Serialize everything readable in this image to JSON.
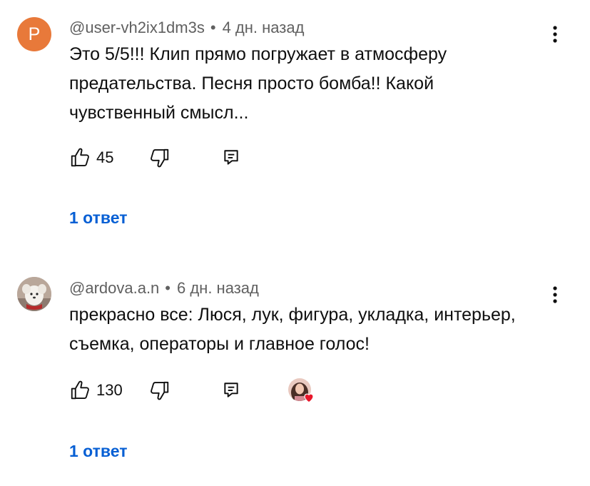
{
  "comments": [
    {
      "avatar_letter": "P",
      "avatar_color": "#e8793a",
      "author": "@user-vh2ix1dm3s",
      "separator": "•",
      "time": "4 дн. назад",
      "text": "Это 5/5!!! Клип прямо погружает в атмосферу предательства. Песня просто бомба!! Какой чувственный смысл...",
      "likes": "45",
      "replies_label": "1 ответ",
      "liked_by_creator": false
    },
    {
      "avatar_icon": "dog-photo-avatar",
      "author": "@ardova.a.n",
      "separator": "•",
      "time": "6 дн. назад",
      "text": "прекрасно все: Люся, лук, фигура, укладка, интерьер, съемка, операторы и главное голос!",
      "likes": "130",
      "replies_label": "1 ответ",
      "liked_by_creator": true
    }
  ],
  "icons": {
    "like": "thumbs-up-icon",
    "dislike": "thumbs-down-icon",
    "reply": "reply-comment-icon",
    "menu": "more-vertical-icon",
    "heart": "heart-icon"
  },
  "colors": {
    "link": "#065fd4",
    "secondary_text": "#606060",
    "heart": "#e8172b"
  }
}
